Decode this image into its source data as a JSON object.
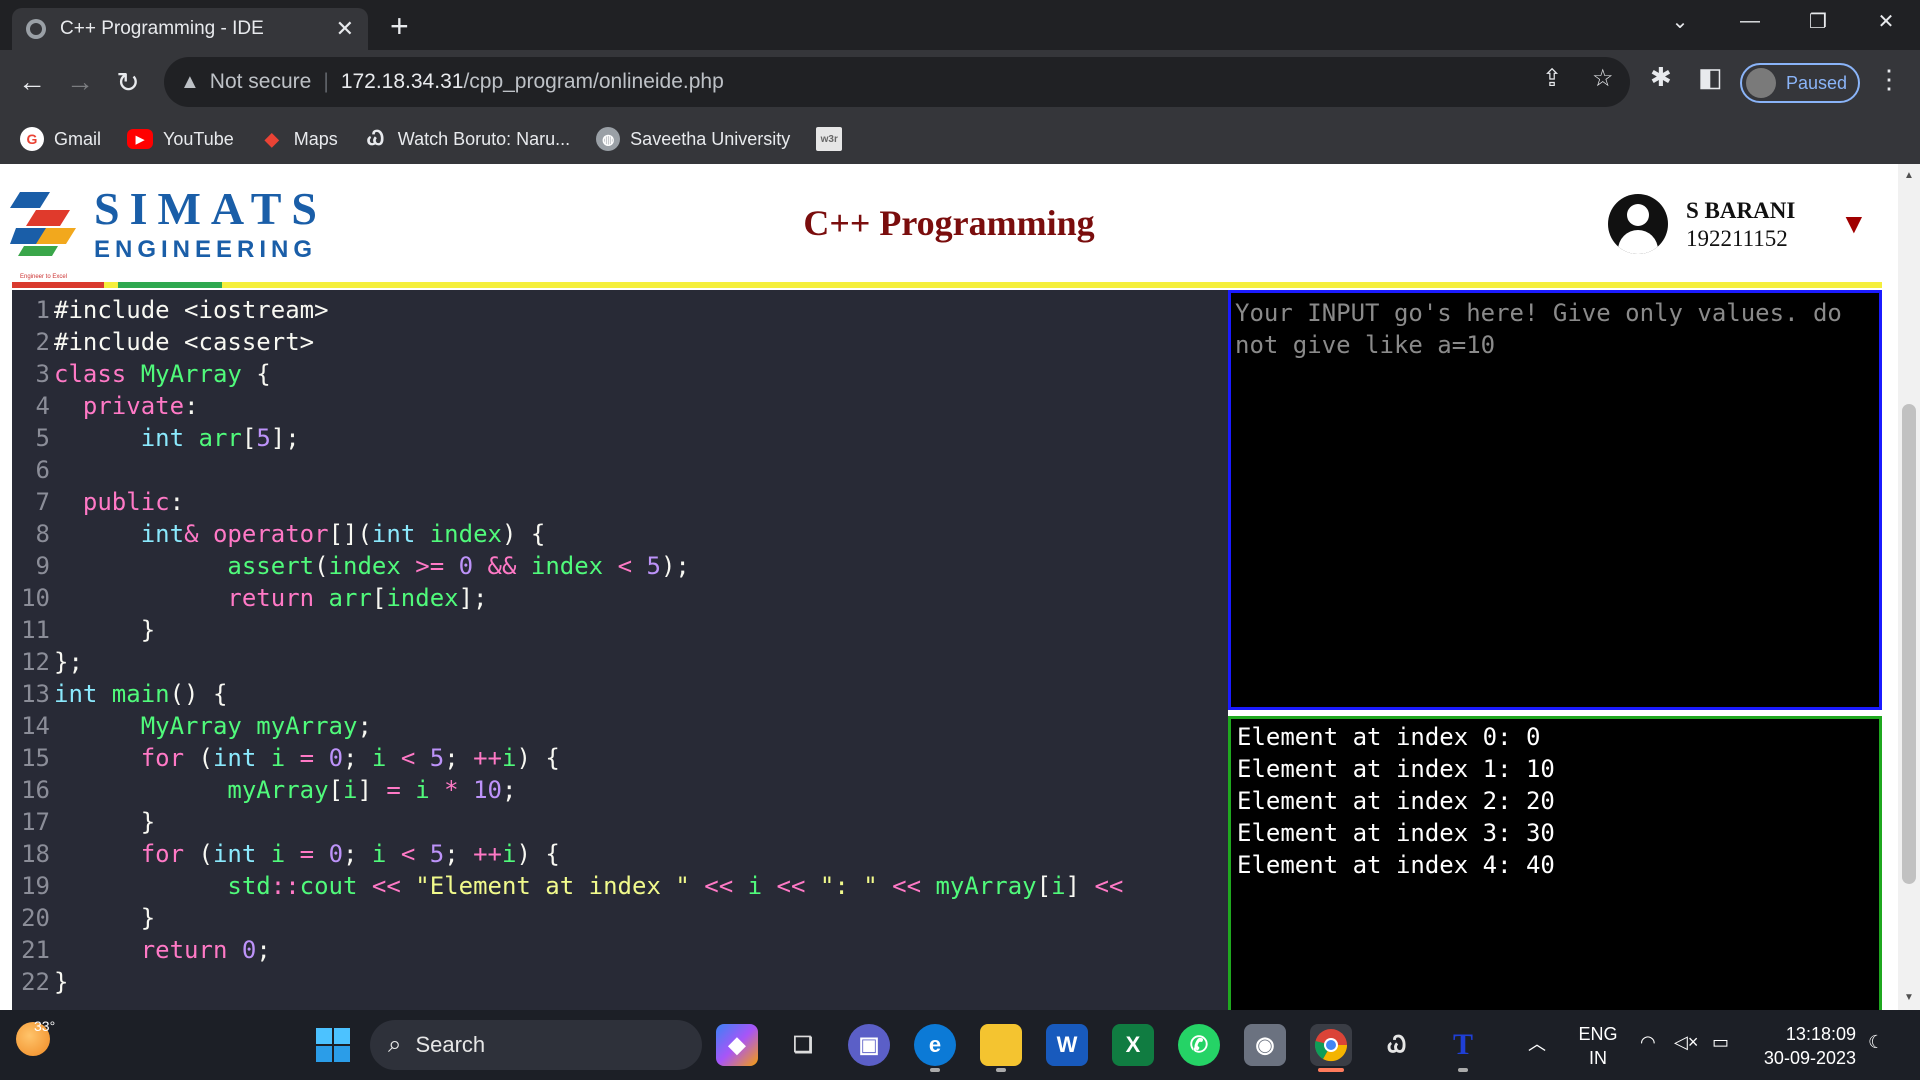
{
  "browser": {
    "tab_title": "C++ Programming - IDE",
    "tab_close": "✕",
    "new_tab": "+",
    "url_warning": "Not secure",
    "url_host": "172.18.34.31",
    "url_path": "/cpp_program/onlineide.php",
    "profile_label": "Paused",
    "bookmarks": [
      {
        "label": "Gmail",
        "icon": "gmail-icon",
        "color": "#ea4335",
        "glyph": "G"
      },
      {
        "label": "YouTube",
        "icon": "youtube-icon",
        "color": "#ff0000",
        "glyph": "▶"
      },
      {
        "label": "Maps",
        "icon": "maps-icon",
        "color": "#34a853",
        "glyph": "◆"
      },
      {
        "label": "Watch Boruto: Naru...",
        "icon": "boruto-site-icon",
        "color": "#35363a",
        "glyph": "Ꮗ"
      },
      {
        "label": "Saveetha University",
        "icon": "globe-icon",
        "color": "#9aa0a6",
        "glyph": "◍"
      },
      {
        "label": "",
        "icon": "w3r-icon",
        "color": "#e6e6e6",
        "glyph": "w3r"
      }
    ]
  },
  "header": {
    "logo_top": "SIMATS",
    "logo_bottom": "ENGINEERING",
    "logo_tagline": "Engineer to Excel",
    "title": "C++ Programming",
    "user_name": "S BARANI",
    "user_id": "192211152",
    "accent": "#7a0d0d"
  },
  "editor": {
    "lines": [
      {
        "n": "1",
        "tokens": [
          [
            "df",
            "#include <iostream>"
          ]
        ]
      },
      {
        "n": "2",
        "tokens": [
          [
            "df",
            "#include <cassert>"
          ]
        ]
      },
      {
        "n": "3",
        "tokens": [
          [
            "kw",
            "class "
          ],
          [
            "fn",
            "MyArray"
          ],
          [
            "df",
            " {"
          ]
        ]
      },
      {
        "n": "4",
        "tokens": [
          [
            "df",
            "  "
          ],
          [
            "kw",
            "private"
          ],
          [
            "df",
            ":"
          ]
        ]
      },
      {
        "n": "5",
        "tokens": [
          [
            "df",
            "      "
          ],
          [
            "ty",
            "int "
          ],
          [
            "fn",
            "arr"
          ],
          [
            "df",
            "["
          ],
          [
            "nm",
            "5"
          ],
          [
            "df",
            "];"
          ]
        ]
      },
      {
        "n": "6",
        "tokens": [
          [
            "df",
            ""
          ]
        ]
      },
      {
        "n": "7",
        "tokens": [
          [
            "df",
            "  "
          ],
          [
            "kw",
            "public"
          ],
          [
            "df",
            ":"
          ]
        ]
      },
      {
        "n": "8",
        "tokens": [
          [
            "df",
            "      "
          ],
          [
            "ty",
            "int"
          ],
          [
            "kw",
            "& "
          ],
          [
            "kw",
            "operator"
          ],
          [
            "df",
            "[]("
          ],
          [
            "ty",
            "int "
          ],
          [
            "fn",
            "index"
          ],
          [
            "df",
            ") {"
          ]
        ]
      },
      {
        "n": "9",
        "tokens": [
          [
            "df",
            "            "
          ],
          [
            "fn",
            "assert"
          ],
          [
            "df",
            "("
          ],
          [
            "fn",
            "index "
          ],
          [
            "kw",
            ">= "
          ],
          [
            "nm",
            "0 "
          ],
          [
            "kw",
            "&& "
          ],
          [
            "fn",
            "index "
          ],
          [
            "kw",
            "< "
          ],
          [
            "nm",
            "5"
          ],
          [
            "df",
            ");"
          ]
        ]
      },
      {
        "n": "10",
        "tokens": [
          [
            "df",
            "            "
          ],
          [
            "kw",
            "return "
          ],
          [
            "fn",
            "arr"
          ],
          [
            "df",
            "["
          ],
          [
            "fn",
            "index"
          ],
          [
            "df",
            "];"
          ]
        ]
      },
      {
        "n": "11",
        "tokens": [
          [
            "df",
            "      }"
          ]
        ]
      },
      {
        "n": "12",
        "tokens": [
          [
            "df",
            "};"
          ]
        ]
      },
      {
        "n": "13",
        "tokens": [
          [
            "ty",
            "int "
          ],
          [
            "fn",
            "main"
          ],
          [
            "df",
            "() {"
          ]
        ]
      },
      {
        "n": "14",
        "tokens": [
          [
            "df",
            "      "
          ],
          [
            "fn",
            "MyArray myArray"
          ],
          [
            "df",
            ";"
          ]
        ]
      },
      {
        "n": "15",
        "tokens": [
          [
            "df",
            "      "
          ],
          [
            "kw",
            "for "
          ],
          [
            "df",
            "("
          ],
          [
            "ty",
            "int "
          ],
          [
            "fn",
            "i "
          ],
          [
            "kw",
            "= "
          ],
          [
            "nm",
            "0"
          ],
          [
            "df",
            "; "
          ],
          [
            "fn",
            "i "
          ],
          [
            "kw",
            "< "
          ],
          [
            "nm",
            "5"
          ],
          [
            "df",
            "; "
          ],
          [
            "kw",
            "++"
          ],
          [
            "fn",
            "i"
          ],
          [
            "df",
            ") {"
          ]
        ]
      },
      {
        "n": "16",
        "tokens": [
          [
            "df",
            "            "
          ],
          [
            "fn",
            "myArray"
          ],
          [
            "df",
            "["
          ],
          [
            "fn",
            "i"
          ],
          [
            "df",
            "] "
          ],
          [
            "kw",
            "= "
          ],
          [
            "fn",
            "i "
          ],
          [
            "kw",
            "* "
          ],
          [
            "nm",
            "10"
          ],
          [
            "df",
            ";"
          ]
        ]
      },
      {
        "n": "17",
        "tokens": [
          [
            "df",
            "      }"
          ]
        ]
      },
      {
        "n": "18",
        "tokens": [
          [
            "df",
            "      "
          ],
          [
            "kw",
            "for "
          ],
          [
            "df",
            "("
          ],
          [
            "ty",
            "int "
          ],
          [
            "fn",
            "i "
          ],
          [
            "kw",
            "= "
          ],
          [
            "nm",
            "0"
          ],
          [
            "df",
            "; "
          ],
          [
            "fn",
            "i "
          ],
          [
            "kw",
            "< "
          ],
          [
            "nm",
            "5"
          ],
          [
            "df",
            "; "
          ],
          [
            "kw",
            "++"
          ],
          [
            "fn",
            "i"
          ],
          [
            "df",
            ") {"
          ]
        ]
      },
      {
        "n": "19",
        "tokens": [
          [
            "df",
            "            "
          ],
          [
            "fn",
            "std"
          ],
          [
            "kw",
            "::"
          ],
          [
            "fn",
            "cout "
          ],
          [
            "kw",
            "<< "
          ],
          [
            "st",
            "\"Element at index \" "
          ],
          [
            "kw",
            "<< "
          ],
          [
            "fn",
            "i "
          ],
          [
            "kw",
            "<< "
          ],
          [
            "st",
            "\": \" "
          ],
          [
            "kw",
            "<< "
          ],
          [
            "fn",
            "myArray"
          ],
          [
            "df",
            "["
          ],
          [
            "fn",
            "i"
          ],
          [
            "df",
            "] "
          ],
          [
            "kw",
            "<<"
          ]
        ]
      },
      {
        "n": "20",
        "tokens": [
          [
            "df",
            "      }"
          ]
        ]
      },
      {
        "n": "21",
        "tokens": [
          [
            "df",
            "      "
          ],
          [
            "kw",
            "return "
          ],
          [
            "nm",
            "0"
          ],
          [
            "df",
            ";"
          ]
        ]
      },
      {
        "n": "22",
        "tokens": [
          [
            "df",
            "}"
          ]
        ]
      }
    ]
  },
  "input_panel": {
    "placeholder": "Your INPUT go's here! Give only values. do not give like a=10"
  },
  "output_panel": {
    "lines": [
      "Element at index 0: 0",
      "Element at index 1: 10",
      "Element at index 2: 20",
      "Element at index 3: 30",
      "Element at index 4: 40"
    ]
  },
  "taskbar": {
    "temperature": "33°",
    "search_label": "Search",
    "language": "ENG",
    "region": "IN",
    "time": "13:18:09",
    "date": "30-09-2023"
  }
}
